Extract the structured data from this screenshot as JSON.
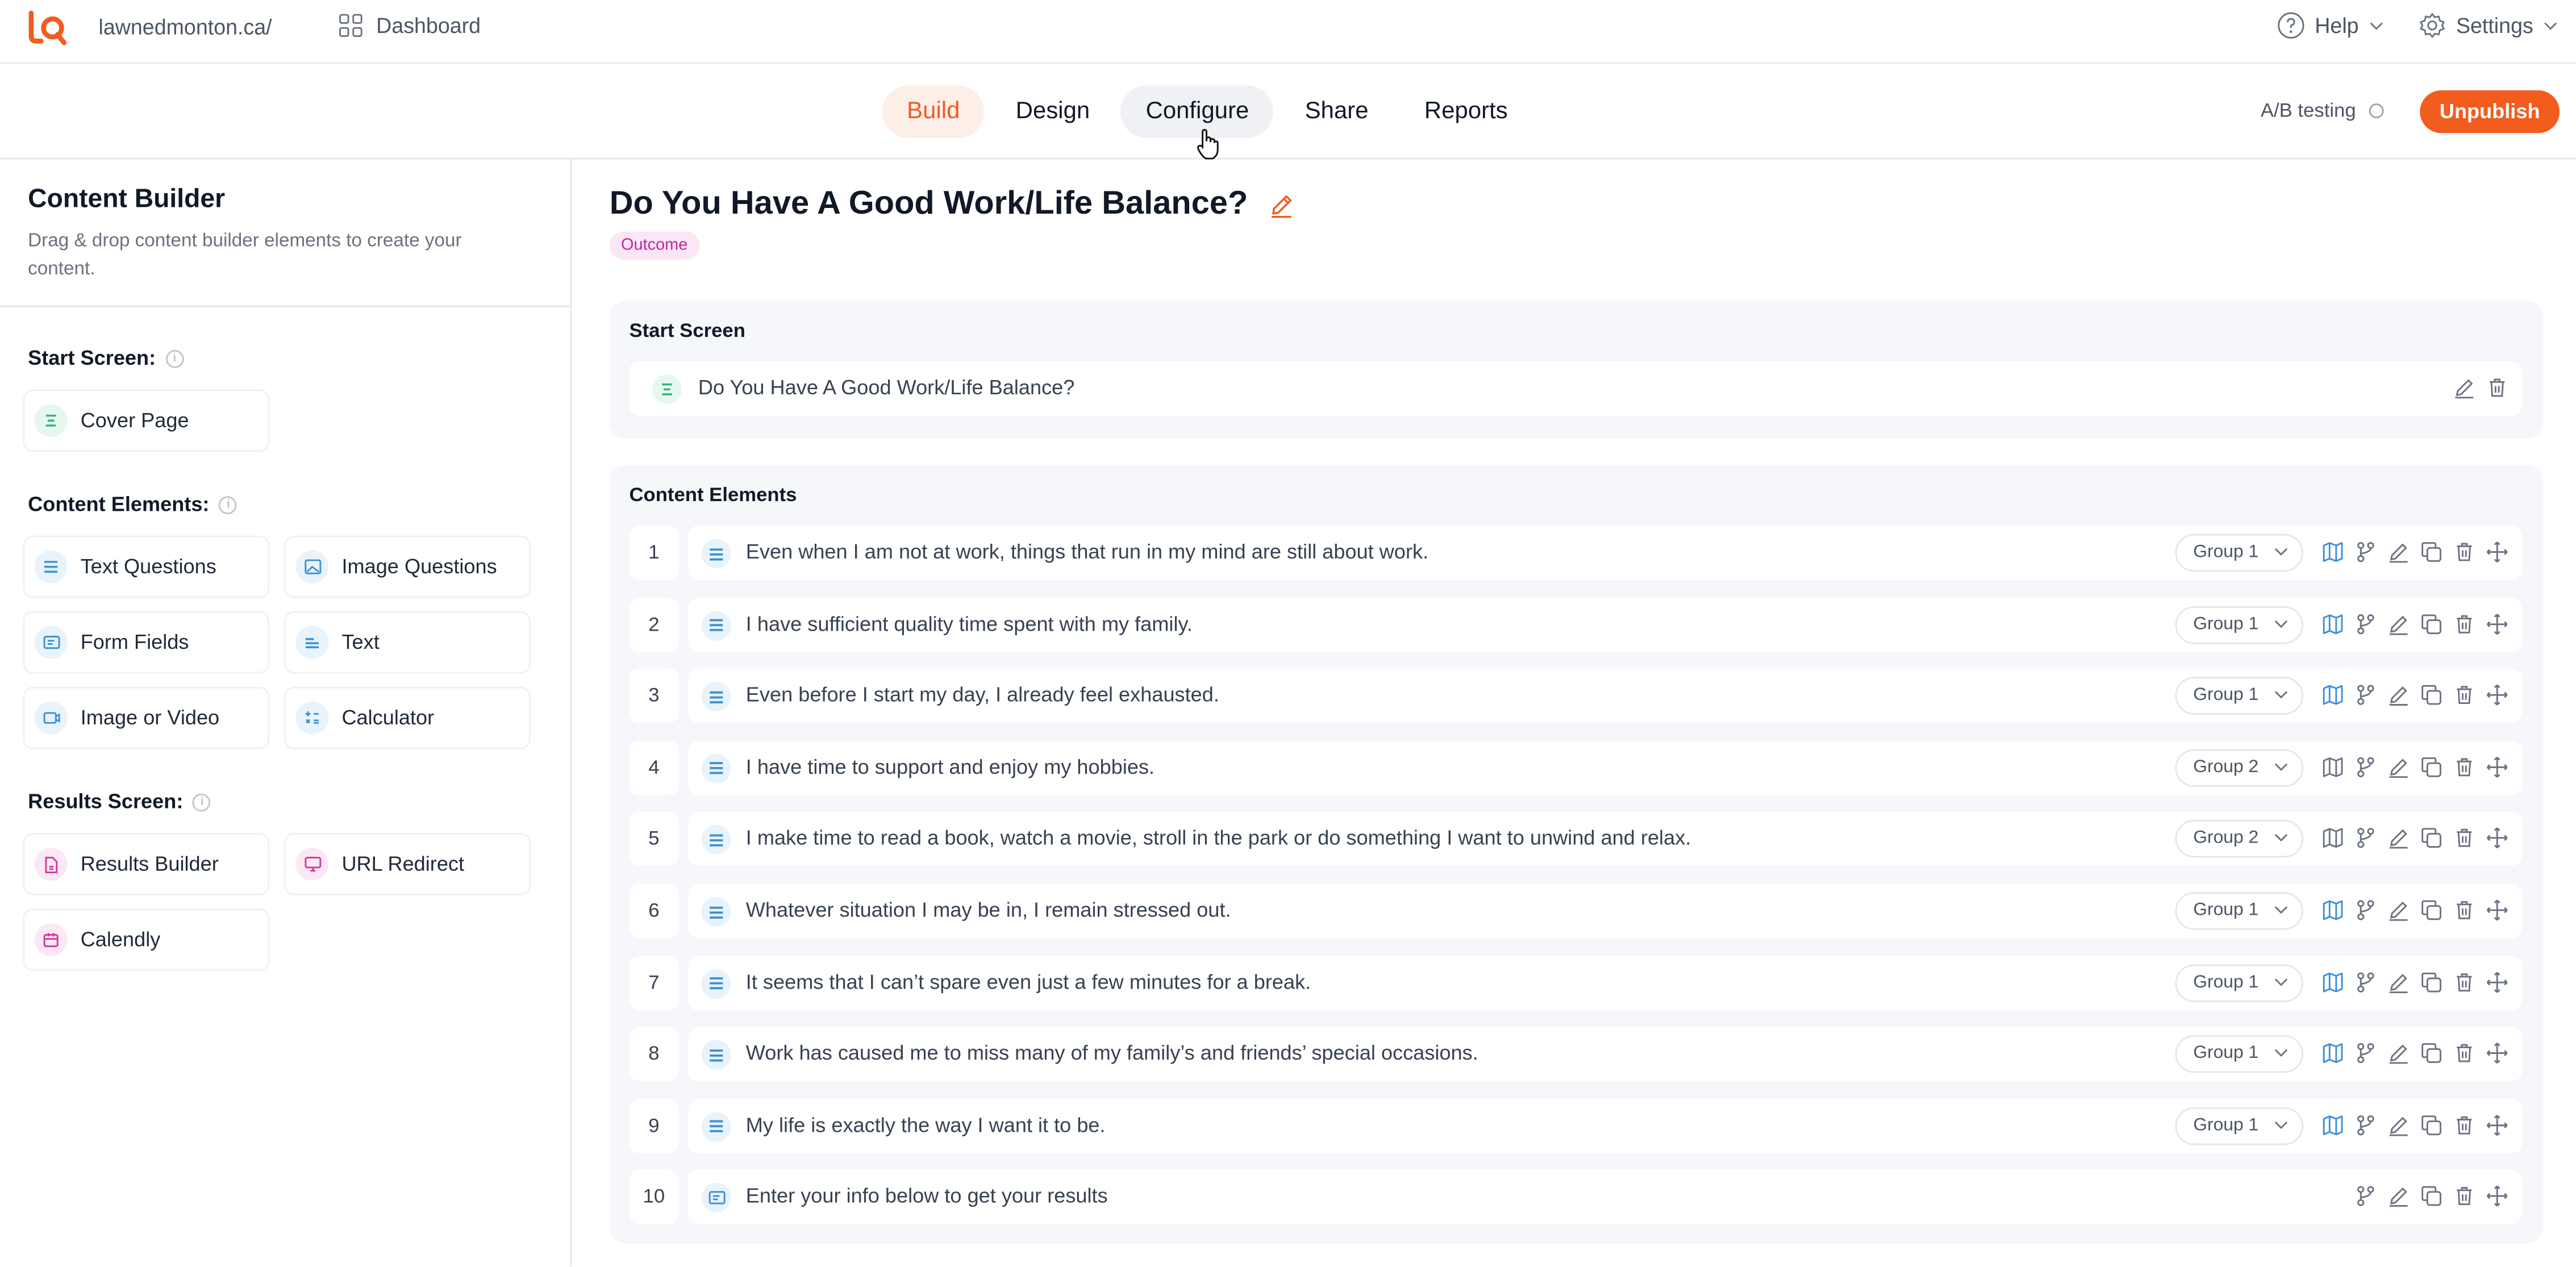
{
  "topbar": {
    "site": "lawnedmonton.ca/",
    "dashboard": "Dashboard",
    "help": "Help",
    "settings": "Settings"
  },
  "nav": {
    "tabs": [
      {
        "label": "Build",
        "state": "active"
      },
      {
        "label": "Design",
        "state": ""
      },
      {
        "label": "Configure",
        "state": "hover"
      },
      {
        "label": "Share",
        "state": ""
      },
      {
        "label": "Reports",
        "state": ""
      }
    ],
    "ab_testing": "A/B testing",
    "unpublish": "Unpublish"
  },
  "sidebar": {
    "title": "Content Builder",
    "subtitle": "Drag & drop content builder elements to create your content.",
    "start_screen_label": "Start Screen:",
    "cover_page": "Cover Page",
    "content_elements_label": "Content Elements:",
    "text_questions": "Text Questions",
    "image_questions": "Image Questions",
    "form_fields": "Form Fields",
    "text": "Text",
    "image_or_video": "Image or Video",
    "calculator": "Calculator",
    "results_screen_label": "Results Screen:",
    "results_builder": "Results Builder",
    "url_redirect": "URL Redirect",
    "calendly": "Calendly"
  },
  "main": {
    "title": "Do You Have A Good Work/Life Balance?",
    "badge": "Outcome",
    "start_screen": {
      "label": "Start Screen",
      "item": "Do You Have A Good Work/Life Balance?"
    },
    "content_elements": {
      "label": "Content Elements",
      "rows": [
        {
          "n": "1",
          "text": "Even when I am not at work, things that run in my mind are still about work.",
          "group": "Group 1",
          "map": true
        },
        {
          "n": "2",
          "text": "I have sufficient quality time spent with my family.",
          "group": "Group 1",
          "map": true
        },
        {
          "n": "3",
          "text": "Even before I start my day, I already feel exhausted.",
          "group": "Group 1",
          "map": true
        },
        {
          "n": "4",
          "text": "I have time to support and enjoy my hobbies.",
          "group": "Group 2",
          "map": false
        },
        {
          "n": "5",
          "text": "I make time to read a book, watch a movie, stroll in the park or do something I want to unwind and relax.",
          "group": "Group 2",
          "map": false
        },
        {
          "n": "6",
          "text": "Whatever situation I may be in, I remain stressed out.",
          "group": "Group 1",
          "map": true
        },
        {
          "n": "7",
          "text": "It seems that I can’t spare even just a few minutes for a break.",
          "group": "Group 1",
          "map": true
        },
        {
          "n": "8",
          "text": "Work has caused me to miss many of my family’s and friends’ special occasions.",
          "group": "Group 1",
          "map": true
        },
        {
          "n": "9",
          "text": "My life is exactly the way I want it to be.",
          "group": "Group 1",
          "map": true
        },
        {
          "n": "10",
          "text": "Enter your info below to get your results",
          "group": "",
          "map": false
        }
      ]
    }
  },
  "colors": {
    "accent": "#f25c1d",
    "active_tab_bg": "#fdeee8",
    "outcome_badge": "#c026a0",
    "panel_bg": "#f5f7fa"
  }
}
